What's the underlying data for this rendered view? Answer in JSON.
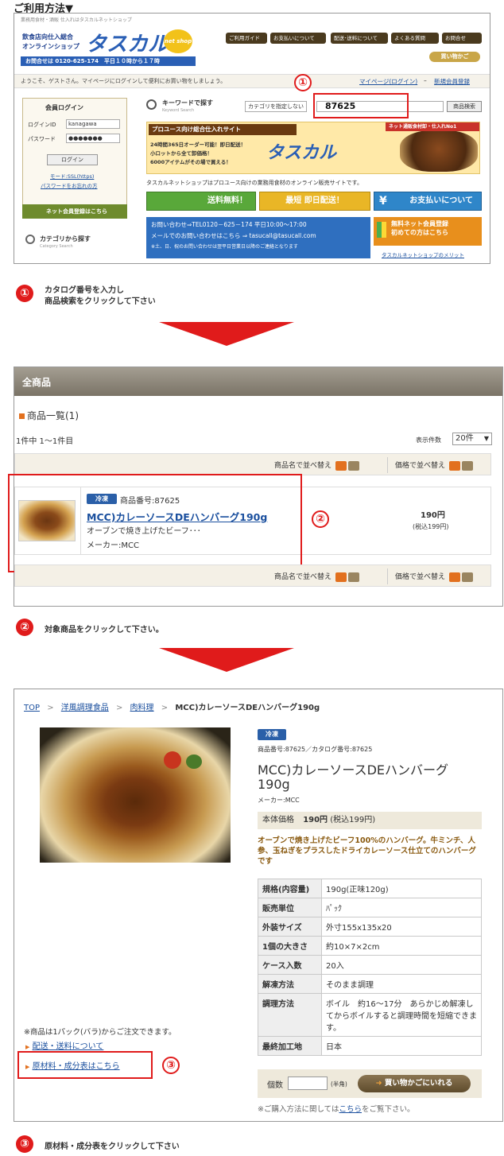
{
  "heading": "ご利用方法▼",
  "step1": {
    "header": {
      "tagline": "業務用食材・酒販 仕入れはタスカルネットショップ",
      "logo_line1": "飲食店向仕入総合",
      "logo_line2": "オンラインショップ",
      "logo_brand": "タスカル",
      "logo_badge": "net shop",
      "phone_bar": "お問合せは 0120-625-174　平日１０時から１７時",
      "nav": [
        "ご利用ガイド",
        "お支払いについて",
        "配送･送料について",
        "よくある質問",
        "お問合せ"
      ],
      "cart_button": "買い物かご",
      "welcome": "ようこそ、ゲストさん。マイページにログインして便利にお買い物をしましょう。",
      "mypage_link": "マイページ(ログイン)",
      "register_link": "新規会員登録"
    },
    "login": {
      "title": "会員ログイン",
      "id_label": "ログインID",
      "id_value": "kanagawa",
      "pw_label": "パスワード",
      "pw_value": "●●●●●●●",
      "button": "ログイン",
      "mode_link": "モード:SSL(https)",
      "forgot_link": "パスワードをお忘れの方",
      "register_banner": "ネット会員登録はこちら",
      "category_title": "カテゴリから探す",
      "category_sub": "Category Search"
    },
    "search": {
      "title": "キーワードで探す",
      "sub": "Keyword Search",
      "category_select": "カテゴリを指定しない",
      "input_value": "87625",
      "button": "商品検索"
    },
    "banner": {
      "title": "プロユース向け総合仕入れサイト",
      "lines": [
        "24時間365日オーダー可能！即日配送！",
        "小ロットから全て卸価格！",
        "6000アイテムがその場で買える！"
      ],
      "side_label": "ネット通販食材卸・仕入れNo1"
    },
    "desc": "タスカルネットショップはプロユース向けの業務用食材のオンライン販売サイトです。",
    "feature_buttons": [
      "送料無料！",
      "最短 即日配送！",
      "お支払いについて"
    ],
    "contact": {
      "line1": "お問い合わせ⇒TEL0120－625－174 平日10:00〜17:00",
      "line2": "メールでのお問い合わせはこちら ⇒ tasucall@tasucall.com",
      "line3": "※土、日、祝のお問い合わせは翌平日営業日以降のご連絡となります"
    },
    "member_banner": {
      "line1": "無料ネット会員登録",
      "line2": "初めての方はこちら",
      "link": "タスカルネットショップのメリット"
    },
    "marker": "①"
  },
  "instruction1": {
    "marker": "①",
    "line1": "カタログ番号を入力し",
    "line2": "商品検索をクリックして下さい"
  },
  "step2": {
    "header": "全商品",
    "list_title": "商品一覧(1)",
    "count": "1件中  1〜1件目",
    "per_page_label": "表示件数",
    "per_page_value": "20件",
    "sort_name": "商品名で並べ替え",
    "sort_price": "価格で並べ替え",
    "badge": "冷凍",
    "product_no": "商品番号:87625",
    "product_name": "MCC)カレーソースDEハンバーグ190g",
    "product_desc": "オーブンで焼き上げたビーフ･･･",
    "maker": "メーカー:MCC",
    "price": "190円",
    "price_tax": "(税込199円)",
    "marker": "②"
  },
  "instruction2": {
    "marker": "②",
    "text": "対象商品をクリックして下さい。"
  },
  "step3": {
    "breadcrumb": [
      "TOP",
      "洋風調理食品",
      "肉料理",
      "MCC)カレーソースDEハンバーグ190g"
    ],
    "badge": "冷凍",
    "numbers": "商品番号:87625／カタログ番号:87625",
    "title_line1": "MCC)カレーソースDEハンバーグ",
    "title_line2": "190g",
    "maker": "メーカー:MCC",
    "price_label": "本体価格",
    "price": "190円",
    "price_tax": "(税込199円)",
    "catch": "オーブンで焼き上げたビーフ100%のハンバーグ。牛ミンチ、人参、玉ねぎをプラスしたドライカレーソース仕立てのハンバーグです",
    "specs": [
      {
        "k": "規格(内容量)",
        "v": "190g(正味120g)"
      },
      {
        "k": "販売単位",
        "v": "ﾊﾟｯｸ"
      },
      {
        "k": "外装サイズ",
        "v": "外寸155x135x20"
      },
      {
        "k": "1個の大きさ",
        "v": "約10×7×2cm"
      },
      {
        "k": "ケース入数",
        "v": "20入"
      },
      {
        "k": "解凍方法",
        "v": "そのまま調理"
      },
      {
        "k": "調理方法",
        "v": "ボイル　約16〜17分　あらかじめ解凍してからボイルすると調理時間を短縮できます。"
      },
      {
        "k": "最終加工地",
        "v": "日本"
      }
    ],
    "note": "※商品は1パック(バラ)からご注文できます。",
    "shipping_link": "配送・送料について",
    "ingredients_link": "原材料・成分表はこちら",
    "qty_label": "個数",
    "qty_unit": "(半角)",
    "cart_button": "買い物かごにいれる",
    "help_prefix": "※ご購入方法に関しては",
    "help_link": "こちら",
    "help_suffix": "をご覧下さい。",
    "marker": "③"
  },
  "instruction3": {
    "marker": "③",
    "text": "原材料・成分表をクリックして下さい"
  }
}
